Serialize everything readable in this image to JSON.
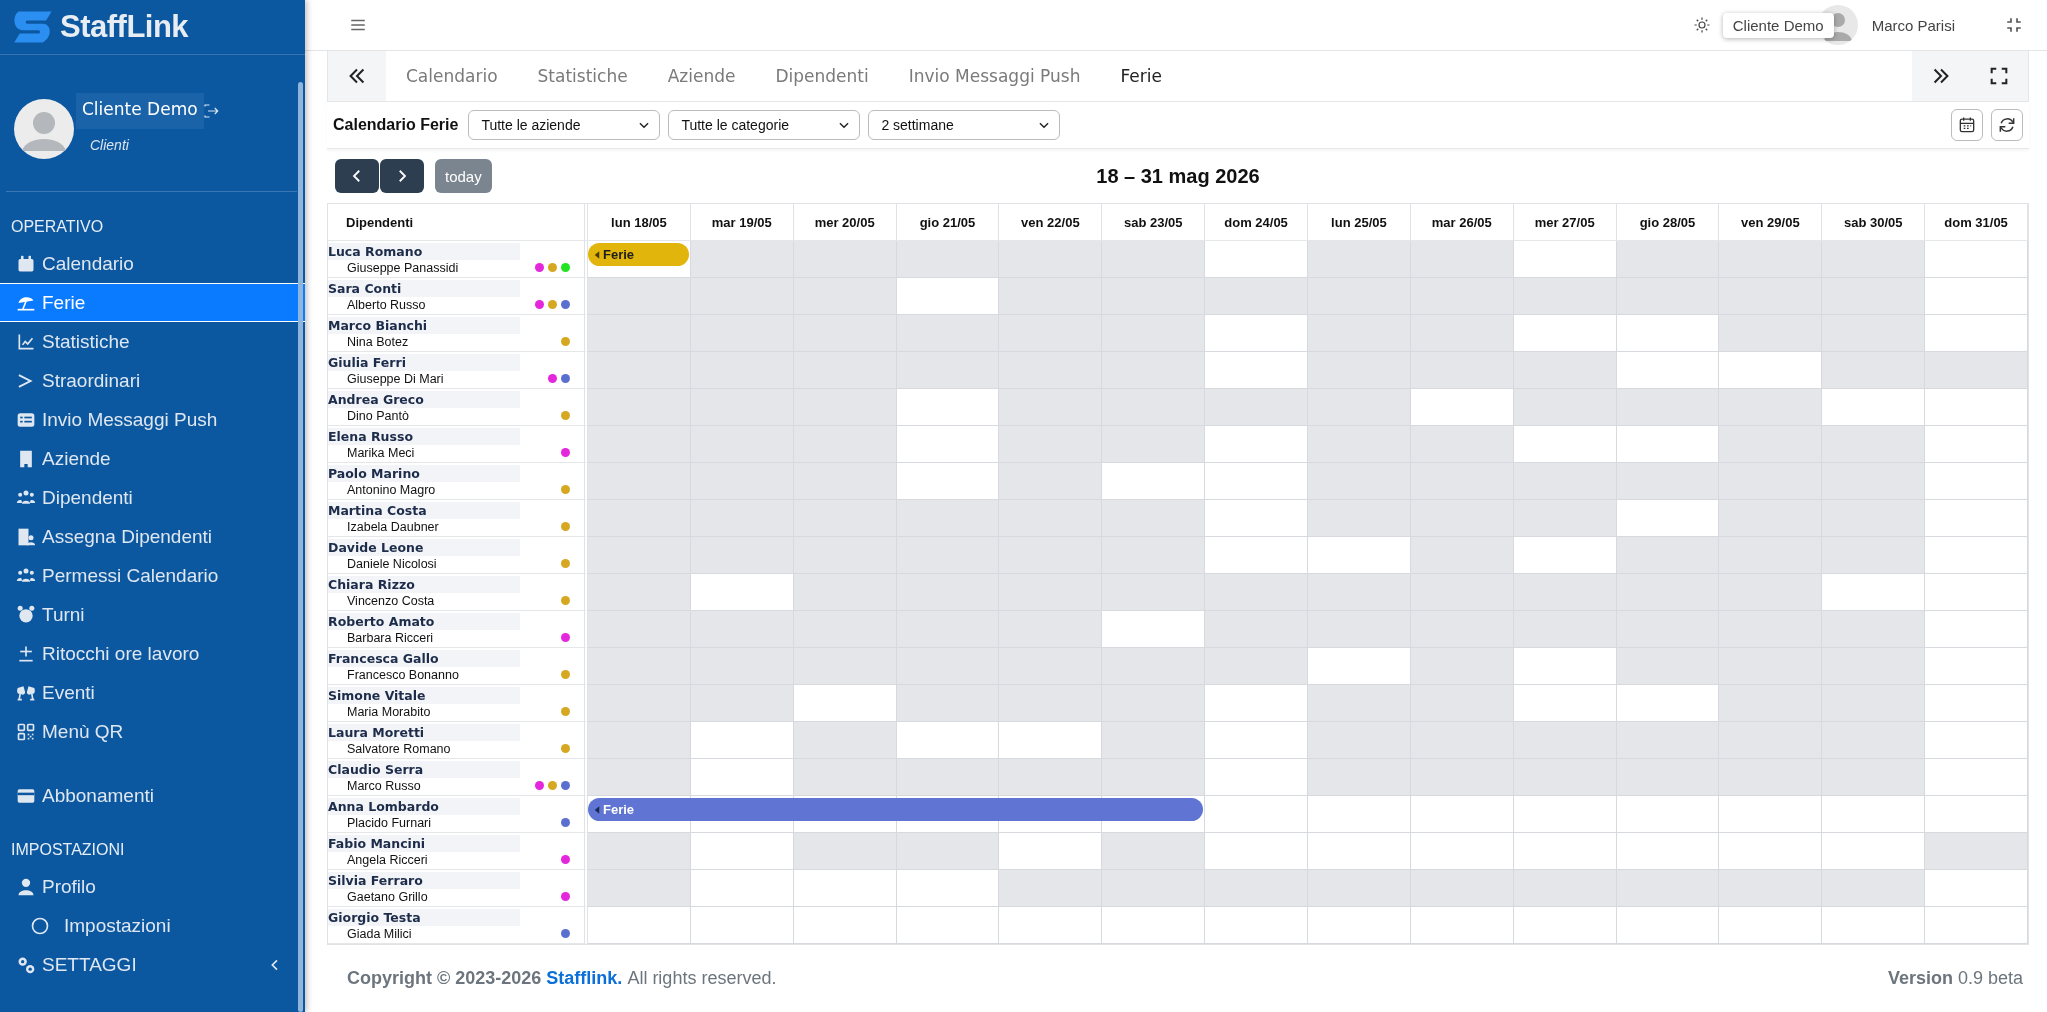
{
  "sidebar": {
    "logo": "StaffLink",
    "user": {
      "name": "Cliente Demo",
      "role": "Clienti"
    },
    "sections": [
      {
        "heading": "OPERATIVO",
        "items": [
          {
            "label": "Calendario",
            "selected": false
          },
          {
            "label": "Ferie",
            "selected": true
          },
          {
            "label": "Statistiche",
            "selected": false
          },
          {
            "label": "Straordinari",
            "selected": false
          },
          {
            "label": "Invio Messaggi Push",
            "selected": false
          },
          {
            "label": "Aziende",
            "selected": false
          },
          {
            "label": "Dipendenti",
            "selected": false
          },
          {
            "label": "Assegna Dipendenti",
            "selected": false
          },
          {
            "label": "Permessi Calendario",
            "selected": false
          },
          {
            "label": "Turni",
            "selected": false
          },
          {
            "label": "Ritocchi ore lavoro",
            "selected": false
          },
          {
            "label": "Eventi",
            "selected": false
          },
          {
            "label": "Menù QR",
            "selected": false
          }
        ]
      },
      {
        "items": [
          {
            "label": "Abbonamenti",
            "selected": false
          }
        ]
      },
      {
        "heading": "IMPOSTAZIONI",
        "items": [
          {
            "label": "Profilo",
            "selected": false,
            "children": [
              {
                "label": "Impostazioni",
                "selected": false
              }
            ]
          },
          {
            "label": "SETTAGGI",
            "selected": false,
            "expanded": false
          }
        ]
      }
    ]
  },
  "topbar": {
    "tooltip": "Cliente Demo",
    "user_name": "Marco Parisi"
  },
  "tabs": [
    {
      "label": "Calendario",
      "selected": false
    },
    {
      "label": "Statistiche",
      "selected": false
    },
    {
      "label": "Aziende",
      "selected": false
    },
    {
      "label": "Dipendenti",
      "selected": false
    },
    {
      "label": "Invio Messaggi Push",
      "selected": false
    },
    {
      "label": "Ferie",
      "selected": true
    }
  ],
  "filters": {
    "title": "Calendario Ferie",
    "selects": [
      {
        "value": "Tutte le aziende"
      },
      {
        "value": "Tutte le categorie"
      },
      {
        "value": "2 settimane"
      }
    ]
  },
  "calendar": {
    "today_button": "today",
    "title": "18 – 31 mag 2026",
    "employee_header": "Dipendenti",
    "days": [
      "lun 18/05",
      "mar 19/05",
      "mer 20/05",
      "gio 21/05",
      "ven 22/05",
      "sab 23/05",
      "dom 24/05",
      "lun 25/05",
      "mar 26/05",
      "mer 27/05",
      "gio 28/05",
      "ven 29/05",
      "sab 30/05",
      "dom 31/05"
    ],
    "rows": [
      {
        "group": "Luca Romano",
        "name": "Giuseppe Panassidi",
        "dots": [
          {
            "color": "#e426dc"
          },
          {
            "color": "#d6a821"
          },
          {
            "color": "#22e322"
          }
        ],
        "event": {
          "label": "Ferie",
          "color": "#e2b50c",
          "days": [
            true,
            false,
            false,
            false,
            false,
            false,
            false,
            false,
            false,
            false,
            false,
            false,
            false,
            false
          ]
        },
        "shaded": [
          false,
          true,
          true,
          true,
          true,
          true,
          false,
          true,
          true,
          false,
          true,
          true,
          true,
          false
        ]
      },
      {
        "group": "Sara Conti",
        "name": "Alberto Russo",
        "dots": [
          {
            "color": "#e426dc"
          },
          {
            "color": "#d6a821"
          },
          {
            "color": "#5b6fcf"
          }
        ],
        "shaded": [
          true,
          true,
          true,
          false,
          true,
          true,
          true,
          true,
          true,
          true,
          true,
          true,
          true,
          false
        ]
      },
      {
        "group": "Marco Bianchi",
        "name": "Nina Botez",
        "dots": [
          {
            "color": "#d6a821"
          }
        ],
        "shaded": [
          true,
          true,
          true,
          true,
          true,
          true,
          false,
          true,
          true,
          false,
          false,
          true,
          true,
          false
        ]
      },
      {
        "group": "Giulia Ferri",
        "name": "Giuseppe Di Mari",
        "dots": [
          {
            "color": "#e426dc"
          },
          {
            "color": "#5b6fcf"
          }
        ],
        "shaded": [
          true,
          true,
          true,
          true,
          true,
          true,
          false,
          true,
          true,
          true,
          false,
          false,
          true,
          true
        ]
      },
      {
        "group": "Andrea Greco",
        "name": "Dino Pantò",
        "dots": [
          {
            "color": "#d6a821"
          }
        ],
        "shaded": [
          true,
          true,
          true,
          false,
          true,
          true,
          true,
          true,
          false,
          true,
          true,
          true,
          false,
          false
        ]
      },
      {
        "group": "Elena Russo",
        "name": "Marika Meci",
        "dots": [
          {
            "color": "#e426dc"
          }
        ],
        "shaded": [
          true,
          true,
          true,
          false,
          true,
          true,
          false,
          true,
          true,
          false,
          false,
          true,
          true,
          false
        ]
      },
      {
        "group": "Paolo Marino",
        "name": "Antonino Magro",
        "dots": [
          {
            "color": "#d6a821"
          }
        ],
        "shaded": [
          true,
          true,
          true,
          false,
          true,
          false,
          false,
          true,
          true,
          true,
          true,
          true,
          true,
          false
        ]
      },
      {
        "group": "Martina Costa",
        "name": "Izabela Daubner",
        "dots": [
          {
            "color": "#d6a821"
          }
        ],
        "shaded": [
          true,
          true,
          true,
          true,
          true,
          true,
          false,
          true,
          true,
          true,
          false,
          true,
          true,
          false
        ]
      },
      {
        "group": "Davide Leone",
        "name": "Daniele Nicolosi",
        "dots": [
          {
            "color": "#d6a821"
          }
        ],
        "shaded": [
          true,
          true,
          true,
          true,
          true,
          true,
          false,
          false,
          true,
          false,
          true,
          true,
          true,
          false
        ]
      },
      {
        "group": "Chiara Rizzo",
        "name": "Vincenzo Costa",
        "dots": [
          {
            "color": "#d6a821"
          }
        ],
        "shaded": [
          true,
          false,
          true,
          true,
          true,
          true,
          true,
          true,
          true,
          true,
          true,
          true,
          false,
          false
        ]
      },
      {
        "group": "Roberto Amato",
        "name": "Barbara Ricceri",
        "dots": [
          {
            "color": "#e426dc"
          }
        ],
        "shaded": [
          true,
          true,
          true,
          true,
          true,
          false,
          true,
          true,
          true,
          true,
          true,
          true,
          true,
          false
        ]
      },
      {
        "group": "Francesca Gallo",
        "name": "Francesco Bonanno",
        "dots": [
          {
            "color": "#d6a821"
          }
        ],
        "shaded": [
          true,
          true,
          true,
          true,
          true,
          true,
          true,
          false,
          true,
          false,
          true,
          true,
          true,
          false
        ]
      },
      {
        "group": "Simone Vitale",
        "name": "Maria Morabito",
        "dots": [
          {
            "color": "#d6a821"
          }
        ],
        "shaded": [
          true,
          true,
          false,
          true,
          true,
          true,
          false,
          true,
          true,
          false,
          false,
          true,
          true,
          false
        ]
      },
      {
        "group": "Laura Moretti",
        "name": "Salvatore Romano",
        "dots": [
          {
            "color": "#d6a821"
          }
        ],
        "shaded": [
          true,
          false,
          true,
          false,
          false,
          true,
          false,
          true,
          true,
          true,
          true,
          true,
          true,
          false
        ]
      },
      {
        "group": "Claudio Serra",
        "name": "Marco Russo",
        "dots": [
          {
            "color": "#e426dc"
          },
          {
            "color": "#d6a821"
          },
          {
            "color": "#5b6fcf"
          }
        ],
        "shaded": [
          true,
          false,
          true,
          true,
          true,
          true,
          false,
          true,
          true,
          true,
          true,
          true,
          true,
          false
        ]
      },
      {
        "group": "Anna Lombardo",
        "name": "Placido Furnari",
        "dots": [
          {
            "color": "#5b6fcf"
          }
        ],
        "event": {
          "label": "Ferie",
          "color": "#5f74d3",
          "days": [
            true,
            true,
            true,
            true,
            true,
            true,
            false,
            false,
            false,
            false,
            false,
            false,
            false,
            false
          ]
        },
        "shaded": [
          false,
          false,
          false,
          false,
          false,
          false,
          false,
          false,
          false,
          false,
          false,
          false,
          false,
          false
        ]
      },
      {
        "group": "Fabio Mancini",
        "name": "Angela Ricceri",
        "dots": [
          {
            "color": "#e426dc"
          }
        ],
        "shaded": [
          true,
          false,
          true,
          true,
          false,
          true,
          false,
          false,
          false,
          false,
          false,
          false,
          false,
          true
        ]
      },
      {
        "group": "Silvia Ferraro",
        "name": "Gaetano Grillo",
        "dots": [
          {
            "color": "#e426dc"
          }
        ],
        "shaded": [
          true,
          false,
          false,
          false,
          true,
          true,
          true,
          true,
          true,
          true,
          true,
          true,
          true,
          false
        ]
      },
      {
        "group": "Giorgio Testa",
        "name": "Giada Milici",
        "dots": [
          {
            "color": "#5b6fcf"
          }
        ],
        "shaded": [
          false,
          false,
          false,
          false,
          false,
          false,
          false,
          false,
          false,
          false,
          false,
          false,
          false,
          false
        ]
      }
    ]
  },
  "footer": {
    "copyright": "Copyright © 2023-2026",
    "link": "Stafflink.",
    "rights": "All rights reserved.",
    "version": "**Version** 0.9 beta"
  }
}
